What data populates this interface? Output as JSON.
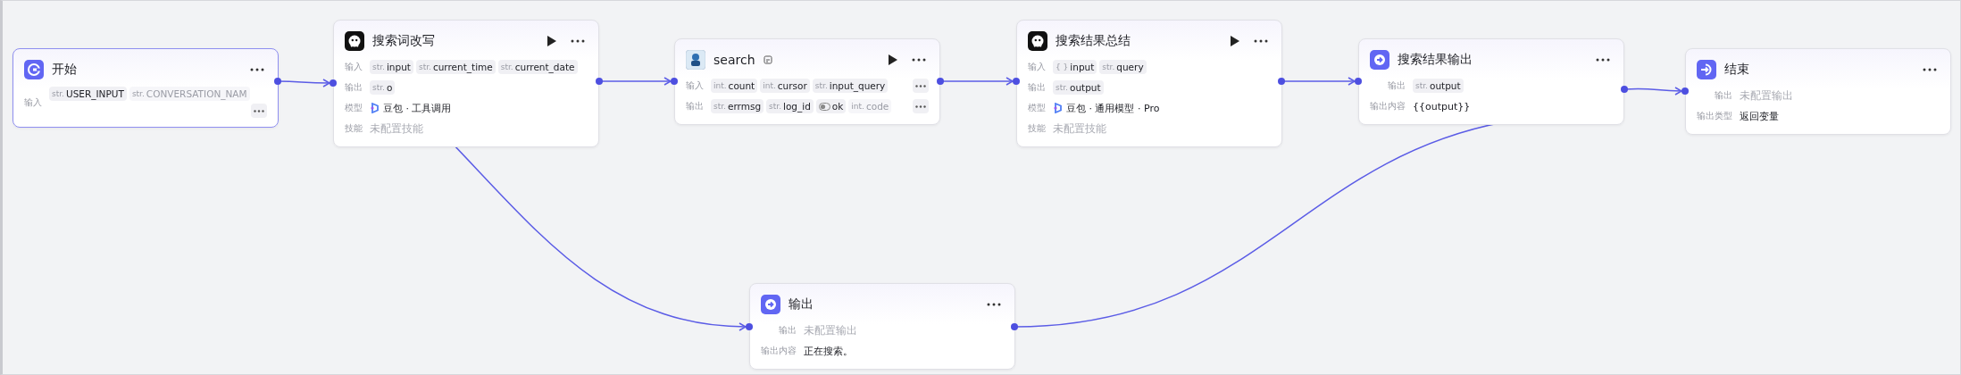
{
  "nodes": [
    {
      "title": "开始",
      "kind": "start",
      "selected": true,
      "run": false,
      "rows": [
        {
          "label": "输入",
          "kind": "params",
          "more": true,
          "params": [
            {
              "kind": "typed",
              "type": "str.",
              "name": "USER_INPUT",
              "faded": false
            },
            {
              "kind": "typed",
              "type": "str.",
              "name": "CONVERSATION_NAM",
              "faded": true
            }
          ]
        }
      ]
    },
    {
      "title": "搜索词改写",
      "kind": "llm",
      "selected": false,
      "run": true,
      "rows": [
        {
          "label": "输入",
          "kind": "params",
          "more": false,
          "params": [
            {
              "kind": "typed",
              "type": "str.",
              "name": "input",
              "faded": false
            },
            {
              "kind": "typed",
              "type": "str.",
              "name": "current_time",
              "faded": false
            },
            {
              "kind": "typed",
              "type": "str.",
              "name": "current_date",
              "faded": false
            }
          ]
        },
        {
          "label": "输出",
          "kind": "params",
          "more": false,
          "params": [
            {
              "kind": "typed",
              "type": "str.",
              "name": "o",
              "faded": false
            }
          ]
        },
        {
          "label": "模型",
          "kind": "model",
          "value": "豆包 · 工具调用"
        },
        {
          "label": "技能",
          "kind": "text",
          "value": "未配置技能",
          "muted": true
        }
      ]
    },
    {
      "title": "search",
      "kind": "plugin",
      "selected": false,
      "run": true,
      "rows": [
        {
          "label": "输入",
          "kind": "params",
          "more": true,
          "params": [
            {
              "kind": "typed",
              "type": "int.",
              "name": "count",
              "faded": false
            },
            {
              "kind": "typed",
              "type": "int.",
              "name": "cursor",
              "faded": false
            },
            {
              "kind": "typed",
              "type": "str.",
              "name": "input_query",
              "faded": false
            }
          ]
        },
        {
          "label": "输出",
          "kind": "params",
          "more": true,
          "params": [
            {
              "kind": "typed",
              "type": "str.",
              "name": "errmsg",
              "faded": false
            },
            {
              "kind": "typed",
              "type": "str.",
              "name": "log_id",
              "faded": false
            },
            {
              "kind": "bool",
              "name": "ok",
              "faded": false
            },
            {
              "kind": "typed",
              "type": "int.",
              "name": "code",
              "faded": true
            }
          ]
        }
      ]
    },
    {
      "title": "搜索结果总结",
      "kind": "llm",
      "selected": false,
      "run": true,
      "rows": [
        {
          "label": "输入",
          "kind": "params",
          "more": false,
          "params": [
            {
              "kind": "typed",
              "type": "{ }",
              "name": "input",
              "faded": false
            },
            {
              "kind": "typed",
              "type": "str.",
              "name": "query",
              "faded": false
            }
          ]
        },
        {
          "label": "输出",
          "kind": "params",
          "more": false,
          "params": [
            {
              "kind": "typed",
              "type": "str.",
              "name": "output",
              "faded": false
            }
          ]
        },
        {
          "label": "模型",
          "kind": "model",
          "value": "豆包 · 通用模型 · Pro"
        },
        {
          "label": "技能",
          "kind": "text",
          "value": "未配置技能",
          "muted": true
        }
      ]
    },
    {
      "title": "搜索结果输出",
      "kind": "output",
      "selected": false,
      "run": false,
      "rows": [
        {
          "label": "输出",
          "kind": "params",
          "more": false,
          "params": [
            {
              "kind": "typed",
              "type": "str.",
              "name": "output",
              "faded": false
            }
          ]
        },
        {
          "label": "输出内容",
          "kind": "text",
          "value": "{{output}}",
          "muted": false
        }
      ]
    },
    {
      "title": "结束",
      "kind": "end",
      "selected": false,
      "run": false,
      "rows": [
        {
          "label": "输出",
          "kind": "text",
          "value": "未配置输出",
          "muted": true
        },
        {
          "label": "输出类型",
          "kind": "text",
          "value": "返回变量",
          "muted": false
        }
      ]
    },
    {
      "title": "输出",
      "kind": "output",
      "selected": false,
      "run": false,
      "rows": [
        {
          "label": "输出",
          "kind": "text",
          "value": "未配置输出",
          "muted": true
        },
        {
          "label": "输出内容",
          "kind": "text",
          "value": "正在搜索。",
          "muted": false
        }
      ]
    }
  ]
}
